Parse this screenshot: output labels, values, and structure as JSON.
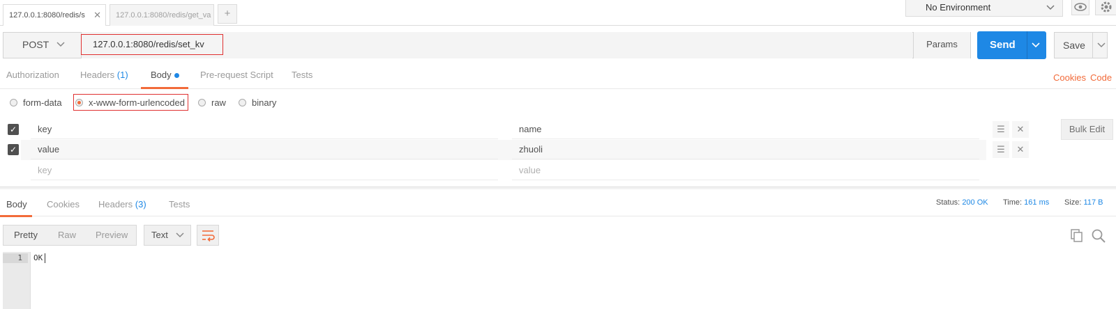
{
  "tabs": [
    {
      "label": "127.0.0.1:8080/redis/s",
      "active": true,
      "close": "✕"
    },
    {
      "label": "127.0.0.1:8080/redis/get_va",
      "active": false
    }
  ],
  "add_tab_label": "+",
  "environment": {
    "selected": "No Environment"
  },
  "request": {
    "method": "POST",
    "url": "127.0.0.1:8080/redis/set_kv",
    "params_label": "Params",
    "send_label": "Send",
    "save_label": "Save"
  },
  "request_tabs": [
    {
      "label": "Authorization"
    },
    {
      "label": "Headers",
      "count": "(1)"
    },
    {
      "label": "Body"
    },
    {
      "label": "Pre-request Script"
    },
    {
      "label": "Tests"
    }
  ],
  "links": {
    "cookies": "Cookies",
    "code": "Code"
  },
  "body_modes": [
    {
      "label": "form-data",
      "selected": false
    },
    {
      "label": "x-www-form-urlencoded",
      "selected": true
    },
    {
      "label": "raw",
      "selected": false
    },
    {
      "label": "binary",
      "selected": false
    }
  ],
  "kv_rows": [
    {
      "key": "key",
      "value": "name",
      "checked": true
    },
    {
      "key": "value",
      "value": "zhuoli",
      "checked": true
    }
  ],
  "kv_placeholder": {
    "key": "key",
    "value": "value"
  },
  "bulk_edit_label": "Bulk Edit",
  "response_tabs": [
    {
      "label": "Body"
    },
    {
      "label": "Cookies"
    },
    {
      "label": "Headers",
      "count": "(3)"
    },
    {
      "label": "Tests"
    }
  ],
  "status": {
    "status_label": "Status:",
    "status_value": "200 OK",
    "time_label": "Time:",
    "time_value": "161 ms",
    "size_label": "Size:",
    "size_value": "117 B"
  },
  "format_tabs": [
    "Pretty",
    "Raw",
    "Preview"
  ],
  "text_type": "Text",
  "response_body": {
    "line_number": "1",
    "content": "OK"
  },
  "colors": {
    "accent": "#f26b3a",
    "send": "#1e88e5",
    "link": "#1e88e5"
  }
}
